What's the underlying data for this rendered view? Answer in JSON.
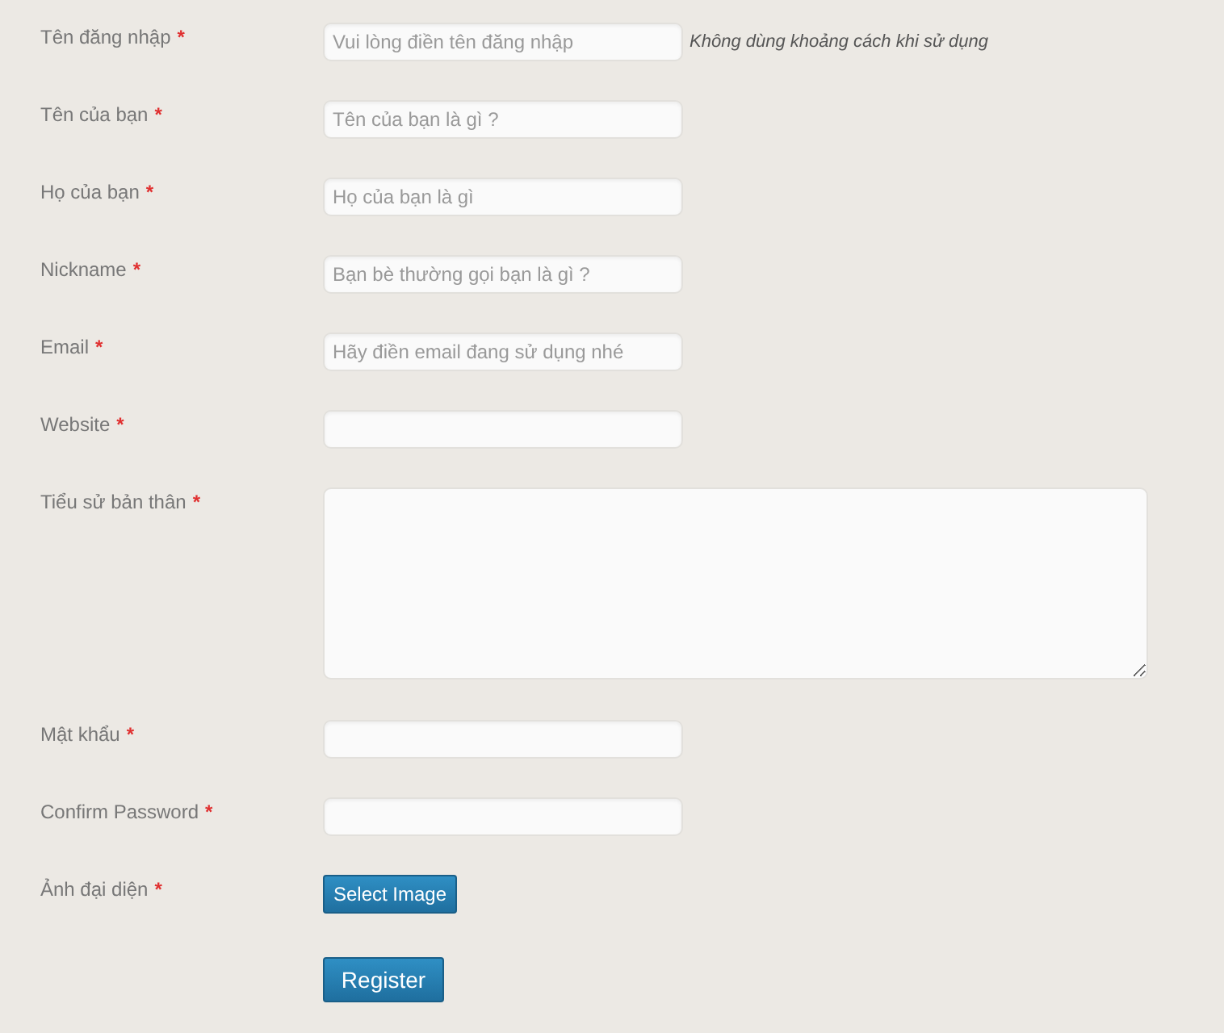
{
  "form_rows": [
    {
      "kind": "input",
      "label": "Tên đăng nhập",
      "required_mark": "*",
      "placeholder": "Vui lòng điền tên đăng nhập",
      "hint": "Không dùng khoảng cách khi sử dụng"
    },
    {
      "kind": "input",
      "label": "Tên của bạn",
      "required_mark": "*",
      "placeholder": "Tên của bạn là gì ?"
    },
    {
      "kind": "input",
      "label": "Họ của bạn",
      "required_mark": "*",
      "placeholder": "Họ của bạn là gì"
    },
    {
      "kind": "input",
      "label": "Nickname",
      "required_mark": "*",
      "placeholder": "Bạn bè thường gọi bạn là gì ?"
    },
    {
      "kind": "input",
      "label": "Email",
      "required_mark": "*",
      "placeholder": "Hãy điền email đang sử dụng nhé"
    },
    {
      "kind": "input",
      "label": "Website",
      "required_mark": "*"
    },
    {
      "kind": "textarea",
      "label": "Tiểu sử bản thân",
      "required_mark": "*"
    },
    {
      "kind": "input",
      "label": "Mật khẩu",
      "required_mark": "*"
    },
    {
      "kind": "input",
      "label": "Confirm Password",
      "required_mark": "*"
    },
    {
      "kind": "button",
      "label": "Ảnh đại diện",
      "required_mark": "*",
      "button": "Select Image"
    }
  ],
  "submit_button": "Register"
}
